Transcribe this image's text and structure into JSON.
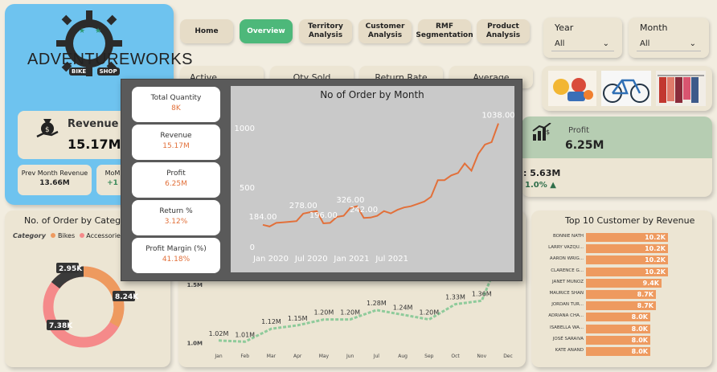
{
  "logo": {
    "brand": "ADVENTUREWORKS",
    "sub_left": "BIKE",
    "sub_right": "SHOP"
  },
  "revenue_card": {
    "title": "Revenue",
    "value": "15.17M"
  },
  "prev_month": {
    "title": "Prev Month Revenue",
    "value": "13.66M"
  },
  "mom_card": {
    "title": "MoM",
    "value": "+1"
  },
  "nav": [
    {
      "label": "Home"
    },
    {
      "label": "Overview"
    },
    {
      "label": "Territory Analysis"
    },
    {
      "label": "Customer Analysis"
    },
    {
      "label": "RMF Segmentation"
    },
    {
      "label": "Product Analysis"
    }
  ],
  "filters": {
    "year": {
      "label": "Year",
      "value": "All"
    },
    "month": {
      "label": "Month",
      "value": "All"
    }
  },
  "kpi_strip": [
    "Active Customer",
    "Qty Sold",
    "Return Rate",
    "Average Spend"
  ],
  "profit_card": {
    "title": "Profit",
    "value": "6.25M",
    "sub_value": ": 5.63M",
    "pct": "1.0% ▲"
  },
  "donut": {
    "title": "No. of Order by Categ",
    "legend_label": "Category",
    "legend_items": [
      "Bikes",
      "Accessorie"
    ],
    "labels": [
      "2.95K",
      "8.24K",
      "7.38K"
    ],
    "colors": [
      "#3a3a3a",
      "#ee9a5f",
      "#f58a8a"
    ]
  },
  "tooltip_cards": [
    {
      "title": "Total Quantity",
      "value": "8K"
    },
    {
      "title": "Revenue",
      "value": "15.17M"
    },
    {
      "title": "Profit",
      "value": "6.25M"
    },
    {
      "title": "Return %",
      "value": "3.12%"
    },
    {
      "title": "Profit Margin (%)",
      "value": "41.18%"
    }
  ],
  "chart_data": [
    {
      "type": "line",
      "title": "No of Order by Month",
      "x_ticks": [
        "Jan 2020",
        "Jul 2020",
        "Jan 2021",
        "Jul 2021"
      ],
      "y_ticks": [
        "0",
        "500",
        "1000"
      ],
      "ylim": [
        0,
        1150
      ],
      "x": [
        0,
        1,
        2,
        3,
        4,
        5,
        6,
        7,
        8,
        9,
        10,
        11,
        12,
        13,
        14,
        15,
        16,
        17,
        18,
        19,
        20,
        21,
        22,
        23,
        24,
        25,
        26,
        27,
        28,
        29,
        30,
        31,
        32,
        33,
        34,
        35
      ],
      "values": [
        184,
        170,
        200,
        205,
        210,
        215,
        278,
        290,
        300,
        196,
        200,
        250,
        260,
        326,
        340,
        242,
        245,
        260,
        300,
        280,
        310,
        330,
        340,
        360,
        380,
        420,
        560,
        560,
        600,
        620,
        700,
        640,
        780,
        860,
        880,
        1038
      ],
      "labels": [
        {
          "index": 0,
          "text": "184.00"
        },
        {
          "index": 6,
          "text": "278.00"
        },
        {
          "index": 9,
          "text": "196.00"
        },
        {
          "index": 13,
          "text": "326.00"
        },
        {
          "index": 15,
          "text": "242.00"
        },
        {
          "index": 35,
          "text": "1038.00"
        }
      ],
      "line_color": "#e2703a"
    },
    {
      "type": "line",
      "categories": [
        "Jan",
        "Feb",
        "Mar",
        "Apr",
        "May",
        "Jun",
        "Jul",
        "Aug",
        "Sep",
        "Oct",
        "Nov",
        "Dec"
      ],
      "values": [
        1.02,
        1.01,
        1.12,
        1.15,
        1.2,
        1.2,
        1.28,
        1.24,
        1.2,
        1.33,
        1.36,
        1.9
      ],
      "labels": [
        "1.02M",
        "1.01M",
        "1.12M",
        "1.15M",
        "1.20M",
        "1.20M",
        "1.28M",
        "1.24M",
        "1.20M",
        "1.33M",
        "1.36M",
        ""
      ],
      "y_ticks": [
        "1.0M",
        "1.5M"
      ],
      "ylim": [
        0.95,
        1.65
      ],
      "line_color": "#8fcb9b"
    },
    {
      "type": "bar",
      "title": "Top 10 Customer by Revenue",
      "categories": [
        "BONNIE NATH",
        "LARRY VAZQU...",
        "AARON WRIG...",
        "CLARENCE G...",
        "JANET MUNOZ",
        "MAURICE SHAN",
        "JORDAN TUR...",
        "ADRIANA CHA...",
        "ISABELLA WA...",
        "JOSÉ SARAIVA",
        "KATE ANAND"
      ],
      "values": [
        10.2,
        10.2,
        10.2,
        10.2,
        9.4,
        8.7,
        8.7,
        8.0,
        8.0,
        8.0,
        8.0
      ],
      "value_labels": [
        "10.2K",
        "10.2K",
        "10.2K",
        "10.2K",
        "9.4K",
        "8.7K",
        "8.7K",
        "8.0K",
        "8.0K",
        "8.0K",
        "8.0K"
      ],
      "bar_color": "#ee9a5f"
    }
  ]
}
